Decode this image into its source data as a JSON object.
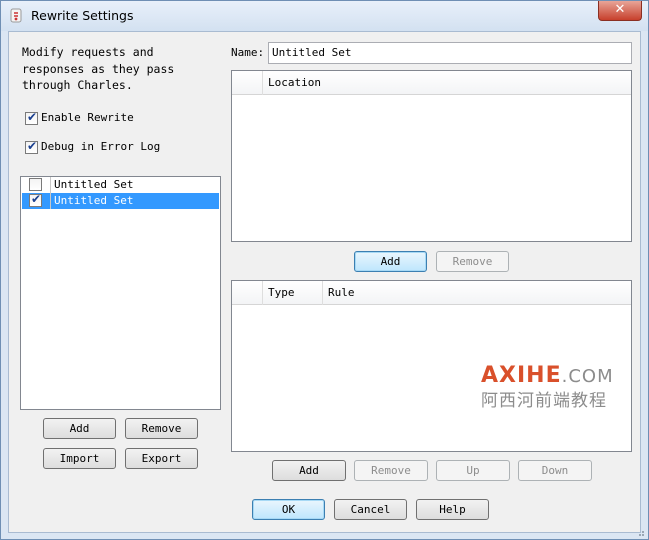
{
  "window": {
    "title": "Rewrite Settings",
    "close_glyph": "✕"
  },
  "left": {
    "description": "Modify requests and\nresponses as they pass\nthrough Charles.",
    "enable_rewrite": {
      "label": "Enable Rewrite",
      "checked": true
    },
    "debug_error_log": {
      "label": "Debug in Error Log",
      "checked": true
    },
    "sets": [
      {
        "label": "Untitled Set",
        "checked": false,
        "selected": false
      },
      {
        "label": "Untitled Set",
        "checked": true,
        "selected": true
      }
    ],
    "buttons": {
      "add": "Add",
      "remove": "Remove",
      "import": "Import",
      "export": "Export"
    }
  },
  "right": {
    "name_label": "Name:",
    "name_value": "Untitled Set",
    "location_table": {
      "columns": [
        "",
        "Location"
      ]
    },
    "location_buttons": {
      "add": "Add",
      "remove": "Remove"
    },
    "rules_table": {
      "columns": [
        "",
        "Type",
        "Rule"
      ]
    },
    "rule_buttons": {
      "add": "Add",
      "remove": "Remove",
      "up": "Up",
      "down": "Down"
    }
  },
  "footer": {
    "ok": "OK",
    "cancel": "Cancel",
    "help": "Help"
  },
  "watermark": {
    "brand": "AXIHE",
    "domain": ".COM",
    "subtitle": "阿西河前端教程"
  },
  "colors": {
    "selection": "#3399ff",
    "brand": "#d9502b",
    "close": "#c7402c"
  }
}
